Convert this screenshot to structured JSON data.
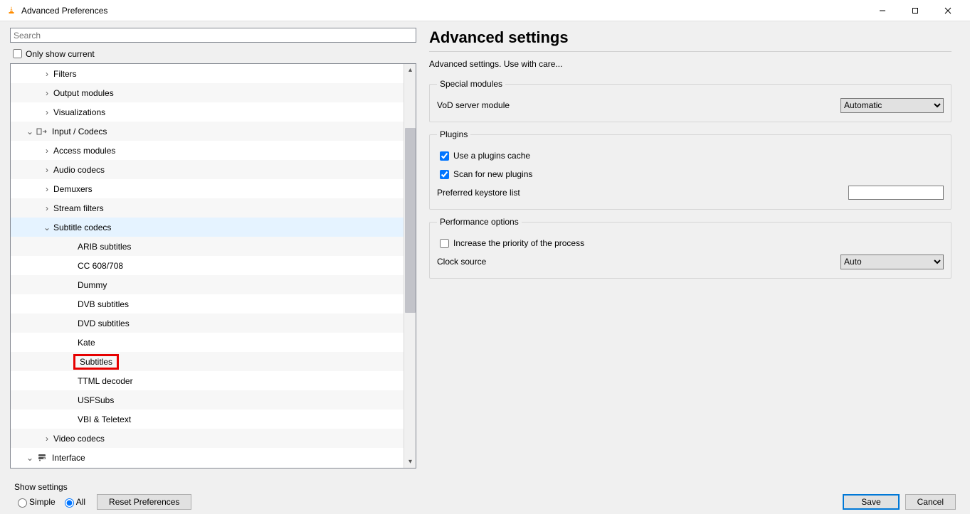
{
  "window": {
    "title": "Advanced Preferences"
  },
  "search": {
    "placeholder": "Search"
  },
  "only_show_current": {
    "label": "Only show current",
    "checked": false
  },
  "tree": {
    "items": [
      {
        "label": "Filters",
        "indent": 1,
        "arrow": "right",
        "stripe": false
      },
      {
        "label": "Output modules",
        "indent": 1,
        "arrow": "right",
        "stripe": true
      },
      {
        "label": "Visualizations",
        "indent": 1,
        "arrow": "right",
        "stripe": false
      },
      {
        "label": "Input / Codecs",
        "indent": 0,
        "arrow": "down",
        "icon": "input-icon",
        "stripe": true
      },
      {
        "label": "Access modules",
        "indent": 1,
        "arrow": "right",
        "stripe": false
      },
      {
        "label": "Audio codecs",
        "indent": 1,
        "arrow": "right",
        "stripe": true
      },
      {
        "label": "Demuxers",
        "indent": 1,
        "arrow": "right",
        "stripe": false
      },
      {
        "label": "Stream filters",
        "indent": 1,
        "arrow": "right",
        "stripe": true
      },
      {
        "label": "Subtitle codecs",
        "indent": 1,
        "arrow": "down",
        "stripe": false,
        "selected": true
      },
      {
        "label": "ARIB subtitles",
        "indent": 2,
        "arrow": "",
        "stripe": true
      },
      {
        "label": "CC 608/708",
        "indent": 2,
        "arrow": "",
        "stripe": false
      },
      {
        "label": "Dummy",
        "indent": 2,
        "arrow": "",
        "stripe": true
      },
      {
        "label": "DVB subtitles",
        "indent": 2,
        "arrow": "",
        "stripe": false
      },
      {
        "label": "DVD subtitles",
        "indent": 2,
        "arrow": "",
        "stripe": true
      },
      {
        "label": "Kate",
        "indent": 2,
        "arrow": "",
        "stripe": false
      },
      {
        "label": "Subtitles",
        "indent": 2,
        "arrow": "",
        "stripe": true,
        "highlight": true
      },
      {
        "label": "TTML decoder",
        "indent": 2,
        "arrow": "",
        "stripe": false
      },
      {
        "label": "USFSubs",
        "indent": 2,
        "arrow": "",
        "stripe": true
      },
      {
        "label": "VBI & Teletext",
        "indent": 2,
        "arrow": "",
        "stripe": false
      },
      {
        "label": "Video codecs",
        "indent": 1,
        "arrow": "right",
        "stripe": true
      },
      {
        "label": "Interface",
        "indent": 0,
        "arrow": "down",
        "icon": "interface-icon",
        "stripe": false
      }
    ]
  },
  "panel": {
    "heading": "Advanced settings",
    "subtext": "Advanced settings. Use with care...",
    "groups": [
      {
        "legend": "Special modules",
        "rows": [
          {
            "type": "select",
            "label": "VoD server module",
            "value": "Automatic"
          }
        ]
      },
      {
        "legend": "Plugins",
        "rows": [
          {
            "type": "checkbox",
            "label": "Use a plugins cache",
            "checked": true
          },
          {
            "type": "checkbox",
            "label": "Scan for new plugins",
            "checked": true
          },
          {
            "type": "text",
            "label": "Preferred keystore list",
            "value": ""
          }
        ]
      },
      {
        "legend": "Performance options",
        "rows": [
          {
            "type": "checkbox",
            "label": "Increase the priority of the process",
            "checked": false
          },
          {
            "type": "select",
            "label": "Clock source",
            "value": "Auto"
          }
        ]
      }
    ]
  },
  "bottom": {
    "show_settings_label": "Show settings",
    "simple_label": "Simple",
    "all_label": "All",
    "mode": "all",
    "reset_label": "Reset Preferences",
    "save_label": "Save",
    "cancel_label": "Cancel"
  }
}
